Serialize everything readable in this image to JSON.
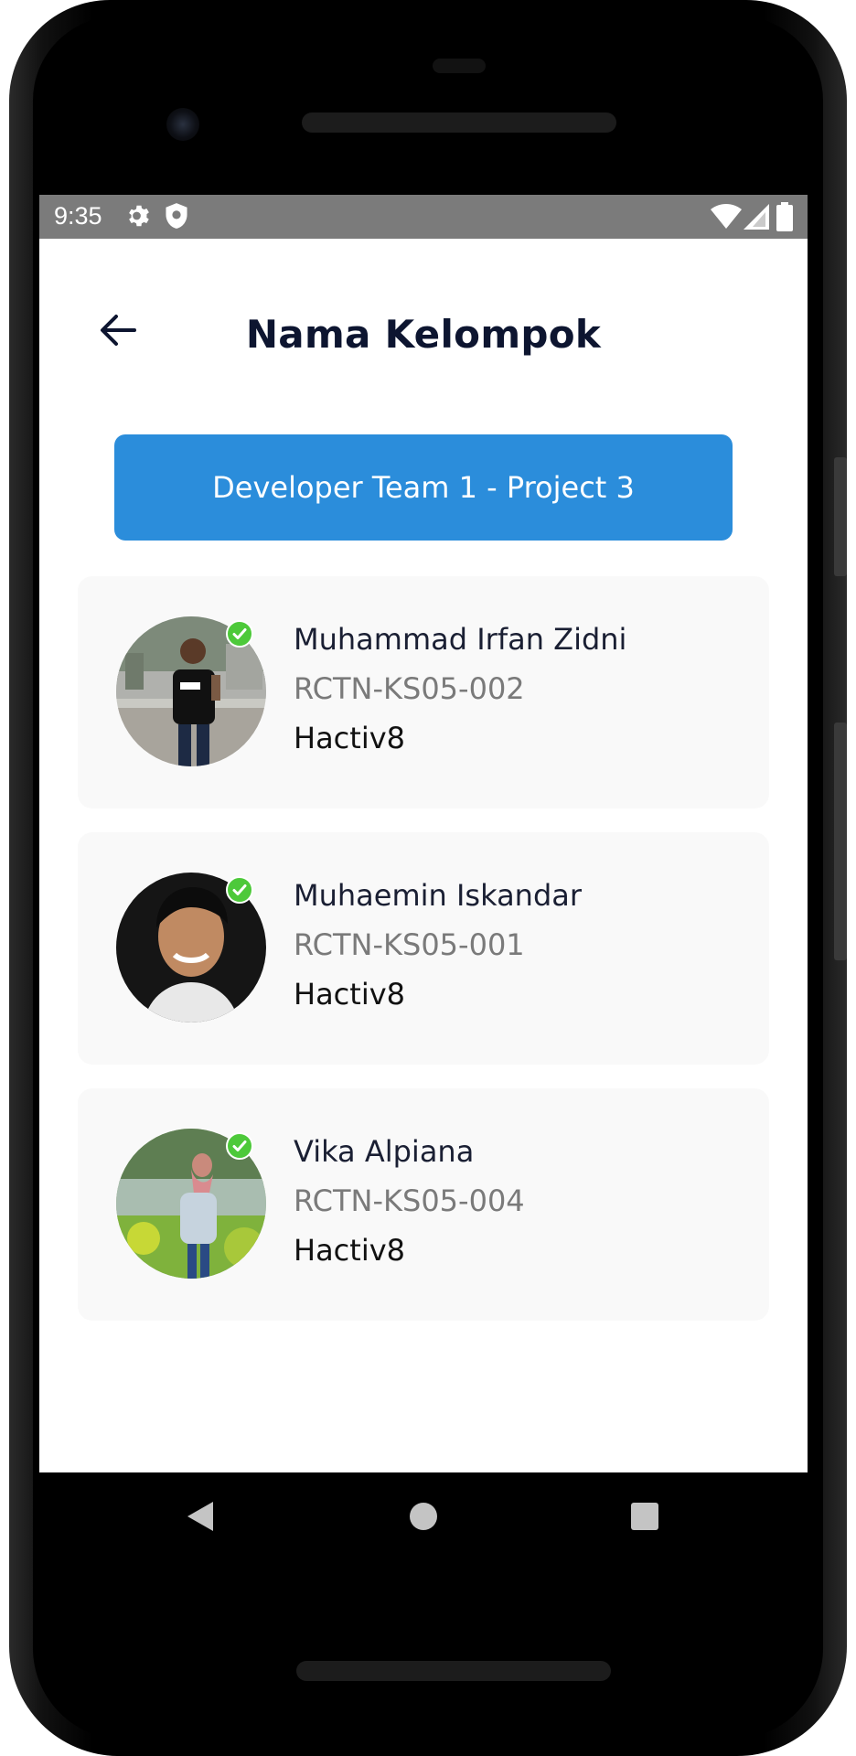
{
  "status_bar": {
    "time": "9:35",
    "icons": [
      "gear-icon",
      "shield-icon",
      "wifi-icon",
      "signal-icon",
      "battery-icon"
    ]
  },
  "header": {
    "title": "Nama Kelompok",
    "back_icon": "arrow-left-icon"
  },
  "team_button": {
    "label": "Developer Team 1 - Project 3",
    "color": "#2b8ddb"
  },
  "members": [
    {
      "name": "Muhammad Irfan Zidni",
      "id": "RCTN-KS05-002",
      "org": "Hactiv8",
      "verified": true
    },
    {
      "name": "Muhaemin Iskandar",
      "id": "RCTN-KS05-001",
      "org": "Hactiv8",
      "verified": true
    },
    {
      "name": "Vika Alpiana",
      "id": "RCTN-KS05-004",
      "org": "Hactiv8",
      "verified": true
    }
  ],
  "nav_bar": {
    "buttons": [
      "back-triangle-icon",
      "home-circle-icon",
      "recents-square-icon"
    ]
  },
  "colors": {
    "status_bar": "#7b7b7b",
    "title": "#0d1530",
    "card_bg": "#f9f9f9",
    "verified": "#4dc93a",
    "id_text": "#7a7a7a"
  }
}
